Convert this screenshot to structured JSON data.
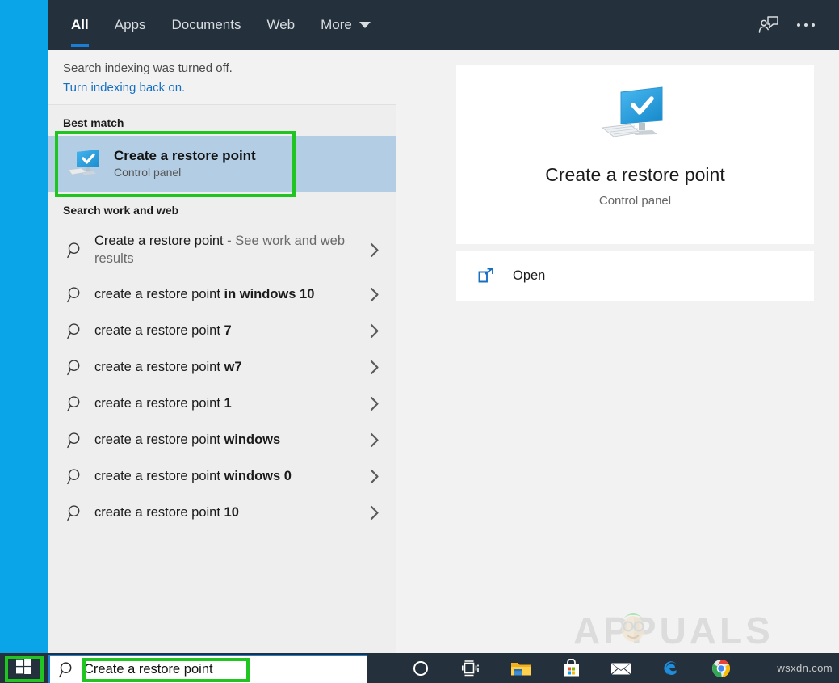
{
  "header": {
    "tabs": [
      {
        "label": "All",
        "active": true
      },
      {
        "label": "Apps",
        "active": false
      },
      {
        "label": "Documents",
        "active": false
      },
      {
        "label": "Web",
        "active": false
      },
      {
        "label": "More",
        "active": false,
        "has_caret": true
      }
    ],
    "feedback_icon": "feedback-person-icon",
    "more_options_icon": "ellipsis-icon"
  },
  "notice": {
    "line1": "Search indexing was turned off.",
    "link": "Turn indexing back on."
  },
  "sections": {
    "best_match_title": "Best match",
    "web_title": "Search work and web"
  },
  "best_match": {
    "title": "Create a restore point",
    "subtitle": "Control panel",
    "icon": "restore-point-monitor-icon",
    "selected": true,
    "highlight_color": "#b3cde4"
  },
  "suggestions": [
    {
      "prefix": "Create a restore point",
      "bold": "",
      "muted": " - See work and web results",
      "two_line": true
    },
    {
      "prefix": "create a restore point ",
      "bold": "in windows 10",
      "muted": "",
      "two_line": false
    },
    {
      "prefix": "create a restore point ",
      "bold": "7",
      "muted": "",
      "two_line": false
    },
    {
      "prefix": "create a restore point ",
      "bold": "w7",
      "muted": "",
      "two_line": false
    },
    {
      "prefix": "create a restore point ",
      "bold": "1",
      "muted": "",
      "two_line": false
    },
    {
      "prefix": "create a restore point ",
      "bold": "windows",
      "muted": "",
      "two_line": false
    },
    {
      "prefix": "create a restore point ",
      "bold": "windows 0",
      "muted": "",
      "two_line": false
    },
    {
      "prefix": "create a restore point ",
      "bold": "10",
      "muted": "",
      "two_line": false
    }
  ],
  "preview": {
    "title": "Create a restore point",
    "subtitle": "Control panel",
    "icon": "restore-point-monitor-icon",
    "actions": [
      {
        "label": "Open",
        "icon": "open-external-icon"
      }
    ]
  },
  "taskbar": {
    "start_icon": "windows-logo-icon",
    "search_value": "Create a restore point",
    "search_icon": "search-magnifier-icon",
    "icons": [
      {
        "name": "cortana-icon"
      },
      {
        "name": "task-view-icon"
      },
      {
        "name": "file-explorer-icon"
      },
      {
        "name": "microsoft-store-icon"
      },
      {
        "name": "mail-icon"
      },
      {
        "name": "edge-icon"
      },
      {
        "name": "chrome-icon"
      }
    ],
    "watermark": "wsxdn.com"
  },
  "watermark": {
    "text": "APPUALS"
  },
  "annotations": {
    "accent_color": "#21c521",
    "targets": [
      "best-match-row",
      "start-button",
      "search-box-text"
    ]
  }
}
